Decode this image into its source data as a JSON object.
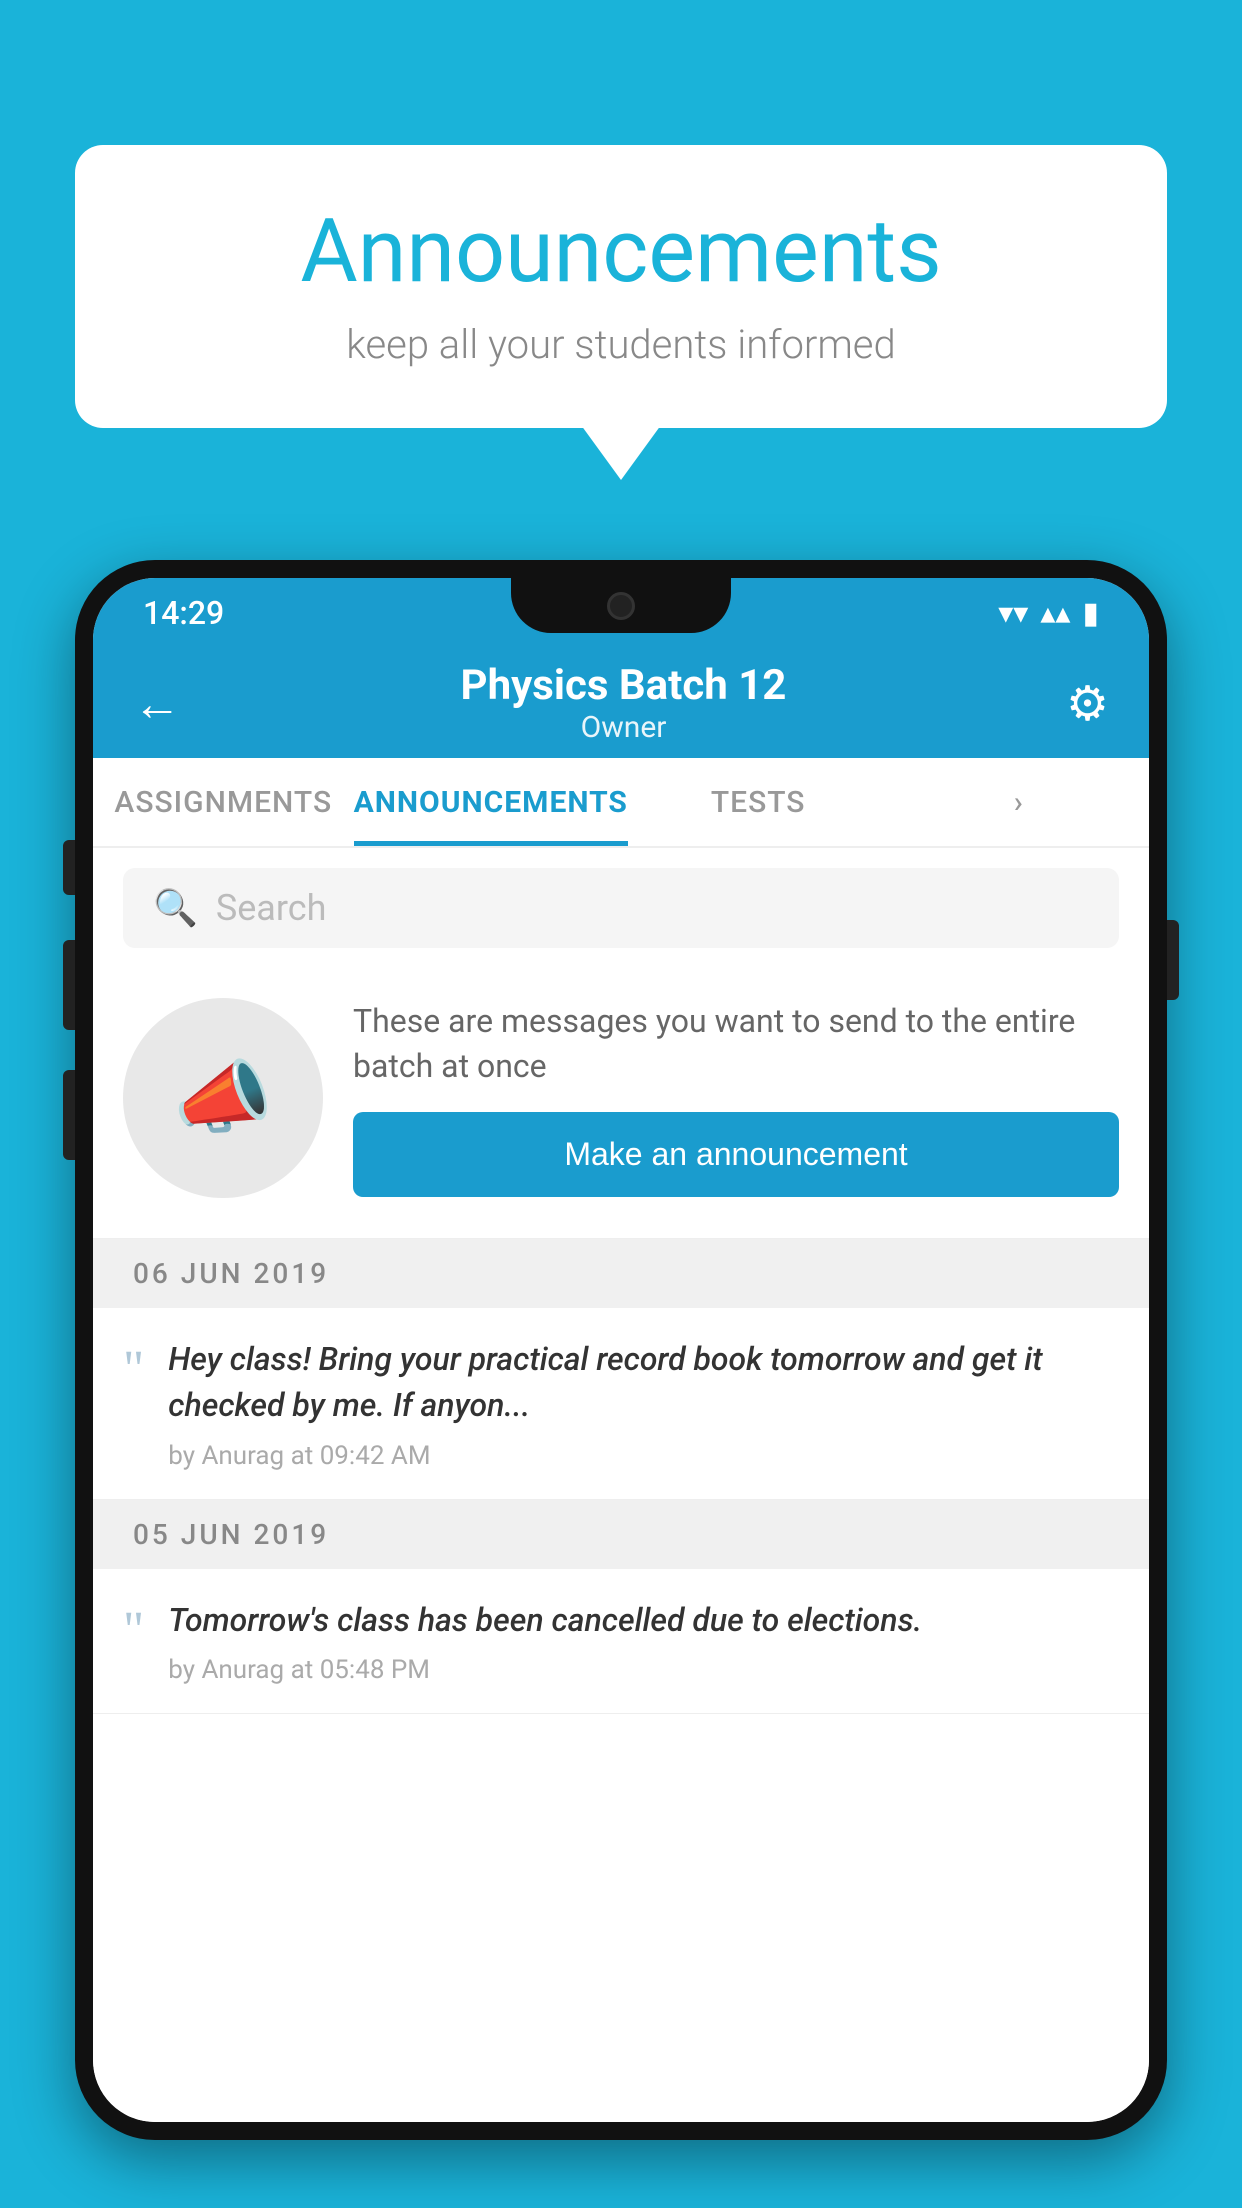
{
  "background_color": "#1ab3d9",
  "speech_bubble": {
    "title": "Announcements",
    "subtitle": "keep all your students informed"
  },
  "phone": {
    "status_bar": {
      "time": "14:29",
      "wifi": "▾",
      "signal": "▴",
      "battery": "▮"
    },
    "header": {
      "back_label": "←",
      "title": "Physics Batch 12",
      "subtitle": "Owner",
      "gear_label": "⚙"
    },
    "tabs": [
      {
        "label": "ASSIGNMENTS",
        "active": false
      },
      {
        "label": "ANNOUNCEMENTS",
        "active": true
      },
      {
        "label": "TESTS",
        "active": false
      },
      {
        "label": "›",
        "active": false
      }
    ],
    "search": {
      "placeholder": "Search"
    },
    "promo": {
      "description": "These are messages you want to send to the entire batch at once",
      "button_label": "Make an announcement"
    },
    "announcements": [
      {
        "date": "06  JUN  2019",
        "text": "Hey class! Bring your practical record book tomorrow and get it checked by me. If anyon...",
        "meta": "by Anurag at 09:42 AM"
      },
      {
        "date": "05  JUN  2019",
        "text": "Tomorrow's class has been cancelled due to elections.",
        "meta": "by Anurag at 05:48 PM"
      }
    ]
  }
}
